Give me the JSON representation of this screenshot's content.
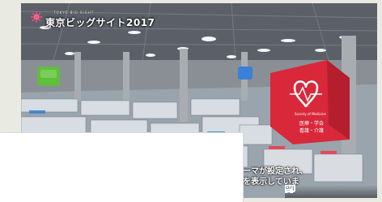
{
  "video": {
    "overlay_title": "東京ビッグサイト2017",
    "overlay_sub": "TOKYO BIG SIGHT",
    "booth_sign_en": "Society of Medicine",
    "booth_sign_jp1": "医療・学会",
    "booth_sign_jp2": "看護・介護",
    "caption_line1": "ーマが設定され、",
    "caption_line2": "を表示していま"
  },
  "controls": {
    "icons": [
      "subtitles-icon",
      "settings-icon",
      "miniplayer-icon",
      "theater-icon",
      "fullscreen-icon"
    ]
  },
  "colors": {
    "sign_red": "#d8283a",
    "balloon_green": "#5fbe3c",
    "balloon_blue": "#3b7fd6"
  }
}
